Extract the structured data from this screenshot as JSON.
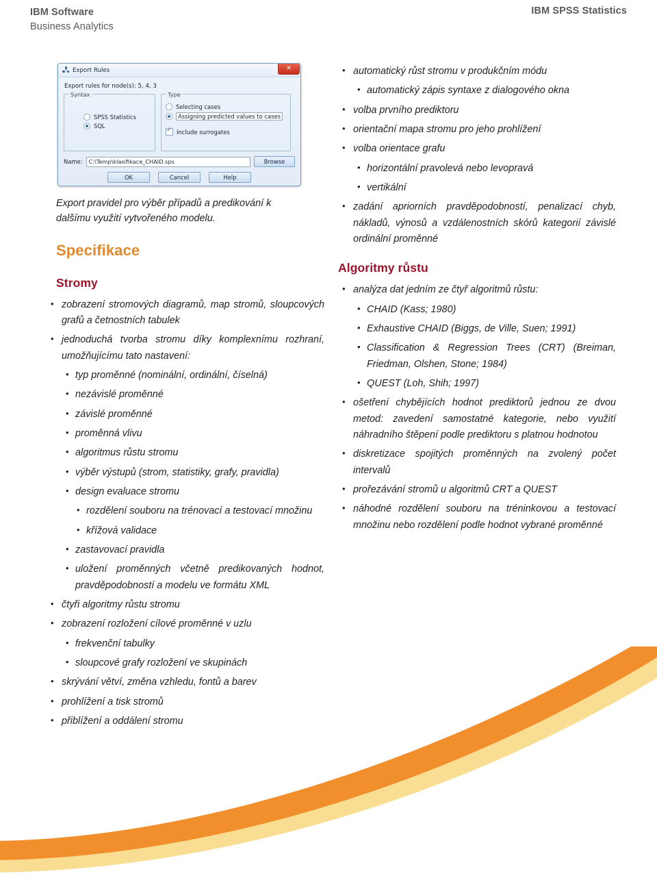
{
  "header": {
    "left_line1": "IBM Software",
    "left_line2": "Business Analytics",
    "right": "IBM SPSS Statistics"
  },
  "dialog": {
    "title": "Export Rules",
    "close_label": "✕",
    "subtitle": "Export rules for node(s): 5, 4, 3",
    "syntax_group": {
      "legend": "Syntax",
      "options": [
        {
          "label": "SPSS Statistics",
          "selected": false
        },
        {
          "label": "SQL",
          "selected": true
        }
      ]
    },
    "type_group": {
      "legend": "Type",
      "options": [
        {
          "label": "Selecting cases",
          "selected": false
        },
        {
          "label": "Assigning predicted values to cases",
          "selected": true
        }
      ],
      "checkbox": {
        "label": "Include surrogates",
        "checked": true
      }
    },
    "name_label": "Name:",
    "name_value": "C:\\Temp\\klasifikace_CHAID.sps",
    "browse_label": "Browse",
    "ok_label": "OK",
    "cancel_label": "Cancel",
    "help_label": "Help"
  },
  "caption": "Export pravidel pro výběr případů a predikování k dalšímu využití vytvořeného modelu.",
  "headings": {
    "specifikace": "Specifikace",
    "stromy": "Stromy",
    "algoritmy": "Algoritmy růstu"
  },
  "colors": {
    "orange_heading": "#e08a2e",
    "red_heading": "#9c1429",
    "header_gray": "#58595b",
    "swoosh_orange": "#f28f2d",
    "swoosh_cream": "#f9dd92"
  },
  "left_column": {
    "bullets": [
      "zobrazení stromových diagramů, map stromů, sloupcových grafů a četnostních tabulek",
      "jednoduchá tvorba stromu díky komplexnímu rozhraní, umožňujícímu tato nastavení:"
    ],
    "sub_bullets_1": [
      "typ proměnné (nominální, ordinální, číselná)",
      "nezávislé proměnné",
      "závislé proměnné",
      "proměnná vlivu",
      "algoritmus růstu stromu",
      "výběr výstupů (strom, statistiky, grafy, pravidla)",
      "design evaluace stromu"
    ],
    "sub_sub_bullets": [
      "rozdělení souboru na trénovací a testovací množinu",
      "křížová validace"
    ],
    "sub_bullets_2": [
      "zastavovací pravidla",
      "uložení proměnných včetně predikovaných hodnot, pravděpodobností a modelu ve formátu XML"
    ],
    "bullets_2": [
      "čtyři algoritmy růstu stromu",
      "zobrazení rozložení cílové proměnné v uzlu"
    ],
    "sub_bullets_3": [
      "frekvenční tabulky",
      "sloupcové grafy rozložení ve skupinách"
    ],
    "bullets_3": [
      "skrývání větví, změna vzhledu, fontů a barev",
      "prohlížení a tisk stromů",
      "přiblížení a oddálení stromu"
    ]
  },
  "right_column": {
    "top_bullets_1": [
      "automatický růst stromu v produkčním módu"
    ],
    "top_sub_1": [
      "automatický zápis syntaxe z dialogového okna"
    ],
    "top_bullets_2": [
      "volba prvního prediktoru",
      "orientační mapa stromu pro jeho prohlížení",
      "volba orientace grafu"
    ],
    "top_sub_2": [
      "horizontální pravolevá nebo levopravá",
      "vertikální"
    ],
    "top_bullets_3": [
      "zadání apriorních pravděpodobností, penalizací chyb, nákladů, výnosů a vzdálenostních skórů kategorií závislé ordinální proměnné"
    ],
    "algo_bullets_1": [
      "analýza dat jedním ze čtyř algoritmů růstu:"
    ],
    "algo_sub": [
      "CHAID (Kass; 1980)",
      "Exhaustive CHAID (Biggs, de Ville, Suen; 1991)",
      "Classification & Regression Trees (CRT) (Breiman, Friedman, Olshen, Stone; 1984)",
      "QUEST (Loh, Shih; 1997)"
    ],
    "algo_bullets_2": [
      "ošetření chybějících hodnot prediktorů jednou ze dvou metod: zavedení samostatné kategorie, nebo využití náhradního štěpení podle prediktoru s platnou hodnotou",
      "diskretizace spojitých proměnných na zvolený počet intervalů",
      "prořezávání stromů u algoritmů CRT a QUEST",
      "náhodné rozdělení souboru na tréninkovou a testovací množinu nebo rozdělení podle hodnot vybrané proměnné"
    ]
  }
}
